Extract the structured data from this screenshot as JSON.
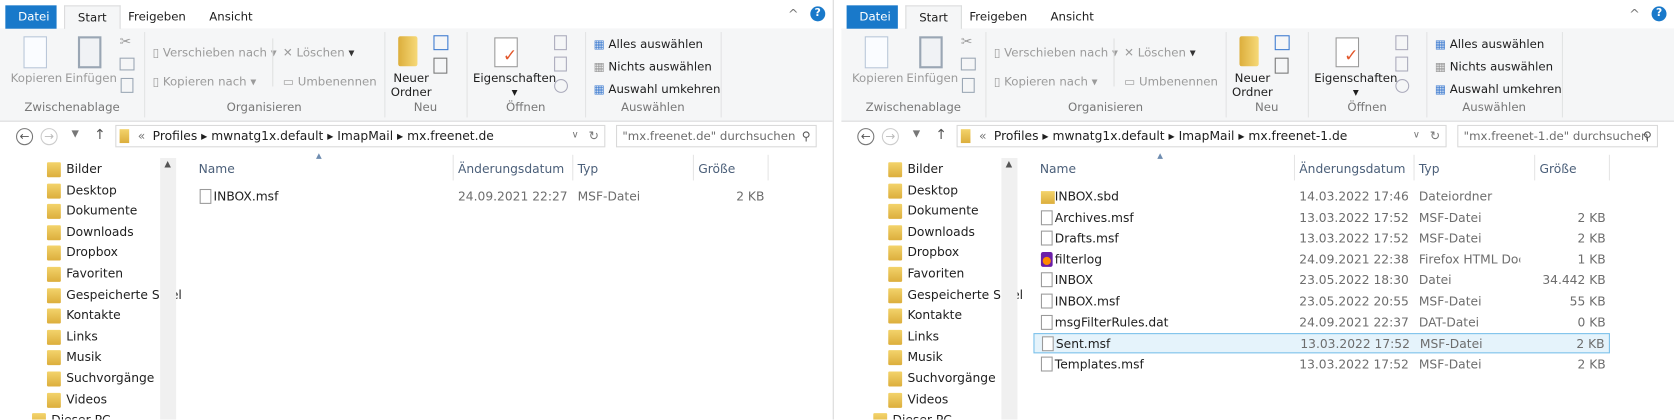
{
  "windows": [
    {
      "tabs": [
        "Datei",
        "Start",
        "Freigeben",
        "Ansicht"
      ],
      "ribbon": {
        "clipboard": {
          "copy": "Kopieren",
          "paste": "Einfügen",
          "label": "Zwischenablage"
        },
        "organize": {
          "move_to": "Verschieben nach",
          "copy_to": "Kopieren nach",
          "delete": "Löschen",
          "rename": "Umbenennen",
          "label": "Organisieren"
        },
        "new": {
          "new_folder_1": "Neuer",
          "new_folder_2": "Ordner",
          "label": "Neu"
        },
        "open": {
          "properties": "Eigenschaften",
          "label": "Öffnen"
        },
        "select": {
          "select_all": "Alles auswählen",
          "select_none": "Nichts auswählen",
          "invert": "Auswahl umkehren",
          "label": "Auswählen"
        }
      },
      "address": {
        "overflow": "«",
        "path": [
          "Profiles",
          "mwnatg1x.default",
          "ImapMail",
          "mx.freenet.de"
        ],
        "search_placeholder": "\"mx.freenet.de\" durchsuchen"
      },
      "nav": [
        "Bilder",
        "Desktop",
        "Dokumente",
        "Downloads",
        "Dropbox",
        "Favoriten",
        "Gespeicherte Spiel",
        "Kontakte",
        "Links",
        "Musik",
        "Suchvorgänge",
        "Videos",
        "Dieser PC"
      ],
      "columns": {
        "name": "Name",
        "date": "Änderungsdatum",
        "type": "Typ",
        "size": "Größe"
      },
      "files": [
        {
          "name": "INBOX.msf",
          "date": "24.09.2021 22:27",
          "type": "MSF-Datei",
          "size": "2 KB",
          "icon": "file"
        }
      ]
    },
    {
      "tabs": [
        "Datei",
        "Start",
        "Freigeben",
        "Ansicht"
      ],
      "ribbon": {
        "clipboard": {
          "copy": "Kopieren",
          "paste": "Einfügen",
          "label": "Zwischenablage"
        },
        "organize": {
          "move_to": "Verschieben nach",
          "copy_to": "Kopieren nach",
          "delete": "Löschen",
          "rename": "Umbenennen",
          "label": "Organisieren"
        },
        "new": {
          "new_folder_1": "Neuer",
          "new_folder_2": "Ordner",
          "label": "Neu"
        },
        "open": {
          "properties": "Eigenschaften",
          "label": "Öffnen"
        },
        "select": {
          "select_all": "Alles auswählen",
          "select_none": "Nichts auswählen",
          "invert": "Auswahl umkehren",
          "label": "Auswählen"
        }
      },
      "address": {
        "overflow": "«",
        "path": [
          "Profiles",
          "mwnatg1x.default",
          "ImapMail",
          "mx.freenet-1.de"
        ],
        "search_placeholder": "\"mx.freenet-1.de\" durchsuchen"
      },
      "nav": [
        "Bilder",
        "Desktop",
        "Dokumente",
        "Downloads",
        "Dropbox",
        "Favoriten",
        "Gespeicherte Spiel",
        "Kontakte",
        "Links",
        "Musik",
        "Suchvorgänge",
        "Videos",
        "Dieser PC"
      ],
      "columns": {
        "name": "Name",
        "date": "Änderungsdatum",
        "type": "Typ",
        "size": "Größe"
      },
      "files": [
        {
          "name": "INBOX.sbd",
          "date": "14.03.2022 17:46",
          "type": "Dateiordner",
          "size": "",
          "icon": "folder"
        },
        {
          "name": "Archives.msf",
          "date": "13.03.2022 17:52",
          "type": "MSF-Datei",
          "size": "2 KB",
          "icon": "file"
        },
        {
          "name": "Drafts.msf",
          "date": "13.03.2022 17:52",
          "type": "MSF-Datei",
          "size": "2 KB",
          "icon": "file"
        },
        {
          "name": "filterlog",
          "date": "24.09.2021 22:38",
          "type": "Firefox HTML Doc...",
          "size": "1 KB",
          "icon": "firefox"
        },
        {
          "name": "INBOX",
          "date": "23.05.2022 18:30",
          "type": "Datei",
          "size": "34.442 KB",
          "icon": "file"
        },
        {
          "name": "INBOX.msf",
          "date": "23.05.2022 20:55",
          "type": "MSF-Datei",
          "size": "55 KB",
          "icon": "file"
        },
        {
          "name": "msgFilterRules.dat",
          "date": "24.09.2021 22:37",
          "type": "DAT-Datei",
          "size": "0 KB",
          "icon": "file"
        },
        {
          "name": "Sent.msf",
          "date": "13.03.2022 17:52",
          "type": "MSF-Datei",
          "size": "2 KB",
          "icon": "file",
          "selected": true
        },
        {
          "name": "Templates.msf",
          "date": "13.03.2022 17:52",
          "type": "MSF-Datei",
          "size": "2 KB",
          "icon": "file"
        }
      ]
    }
  ],
  "colors": {
    "file_tab": "#1979ca",
    "selection": "#e5f3fb",
    "selection_border": "#7ac0ea"
  }
}
